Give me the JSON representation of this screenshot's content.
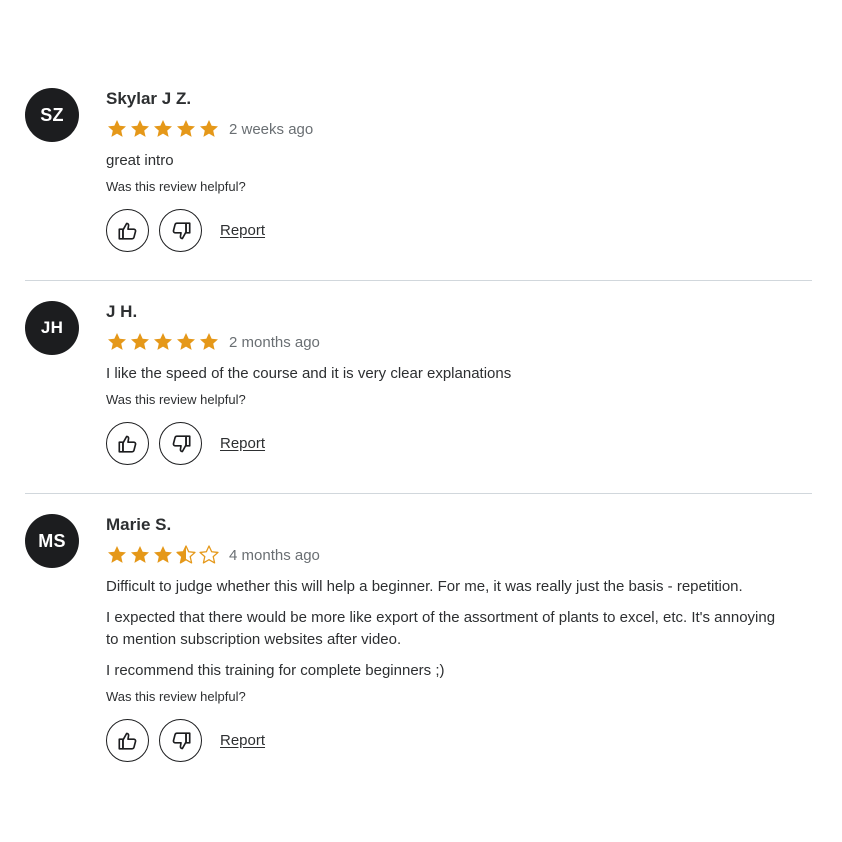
{
  "reviews": [
    {
      "initials": "SZ",
      "name": "Skylar J Z.",
      "rating": 5,
      "time": "2 weeks ago",
      "paragraphs": [
        "great intro"
      ],
      "helpful_question": "Was this review helpful?",
      "report_label": "Report"
    },
    {
      "initials": "JH",
      "name": "J H.",
      "rating": 5,
      "time": "2 months ago",
      "paragraphs": [
        "I like the speed of the course and it is very clear explanations"
      ],
      "helpful_question": "Was this review helpful?",
      "report_label": "Report"
    },
    {
      "initials": "MS",
      "name": "Marie S.",
      "rating": 3.5,
      "time": "4 months ago",
      "paragraphs": [
        "Difficult to judge whether this will help a beginner. For me, it was really just the basis - repetition.",
        "I expected that there would be more like export of the assortment of plants to excel, etc. It's annoying to mention subscription websites after video.",
        "I recommend this training for complete beginners ;)"
      ],
      "helpful_question": "Was this review helpful?",
      "report_label": "Report"
    }
  ],
  "icons": {
    "thumbs_up": "thumbs-up-icon",
    "thumbs_down": "thumbs-down-icon",
    "star_full": "star-filled-icon",
    "star_half": "star-half-icon",
    "star_empty": "star-empty-icon"
  },
  "colors": {
    "star": "#e59819",
    "avatar_bg": "#1c1d1f",
    "text": "#2d2f31",
    "muted": "#6a6f73",
    "divider": "#d1d7dc"
  }
}
